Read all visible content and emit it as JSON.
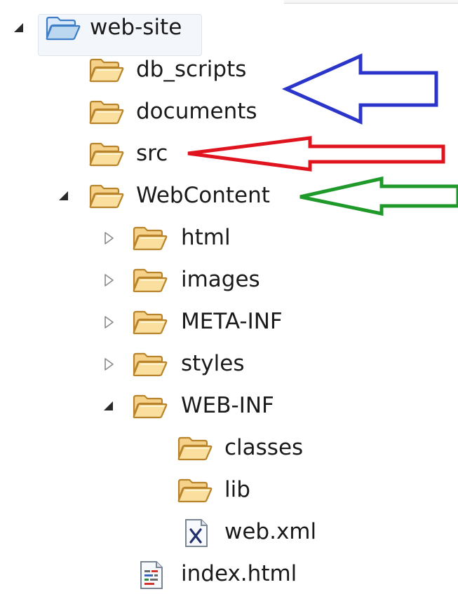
{
  "tree": {
    "root": {
      "label": "web-site",
      "icon": "open-folder-icon",
      "expanded": true,
      "selected": true
    },
    "items": [
      {
        "label": "db_scripts",
        "icon": "folder-icon"
      },
      {
        "label": "documents",
        "icon": "folder-icon"
      },
      {
        "label": "src",
        "icon": "folder-icon"
      },
      {
        "label": "WebContent",
        "icon": "folder-icon",
        "expanded": true
      },
      {
        "label": "html",
        "icon": "folder-icon",
        "expanded": false
      },
      {
        "label": "images",
        "icon": "folder-icon",
        "expanded": false
      },
      {
        "label": "META-INF",
        "icon": "folder-icon",
        "expanded": false
      },
      {
        "label": "styles",
        "icon": "folder-icon",
        "expanded": false
      },
      {
        "label": "WEB-INF",
        "icon": "folder-icon",
        "expanded": true
      },
      {
        "label": "classes",
        "icon": "folder-icon"
      },
      {
        "label": "lib",
        "icon": "folder-icon"
      },
      {
        "label": "web.xml",
        "icon": "xml-file-icon"
      },
      {
        "label": "index.html",
        "icon": "html-file-icon"
      }
    ]
  },
  "annotations": {
    "colors": {
      "blue": "#2b35c9",
      "red": "#e0141e",
      "green": "#1f9a2a"
    }
  },
  "colors": {
    "folder": "#f3c777",
    "folder_edge": "#b8842b",
    "root_folder": "#bcd7f0"
  }
}
